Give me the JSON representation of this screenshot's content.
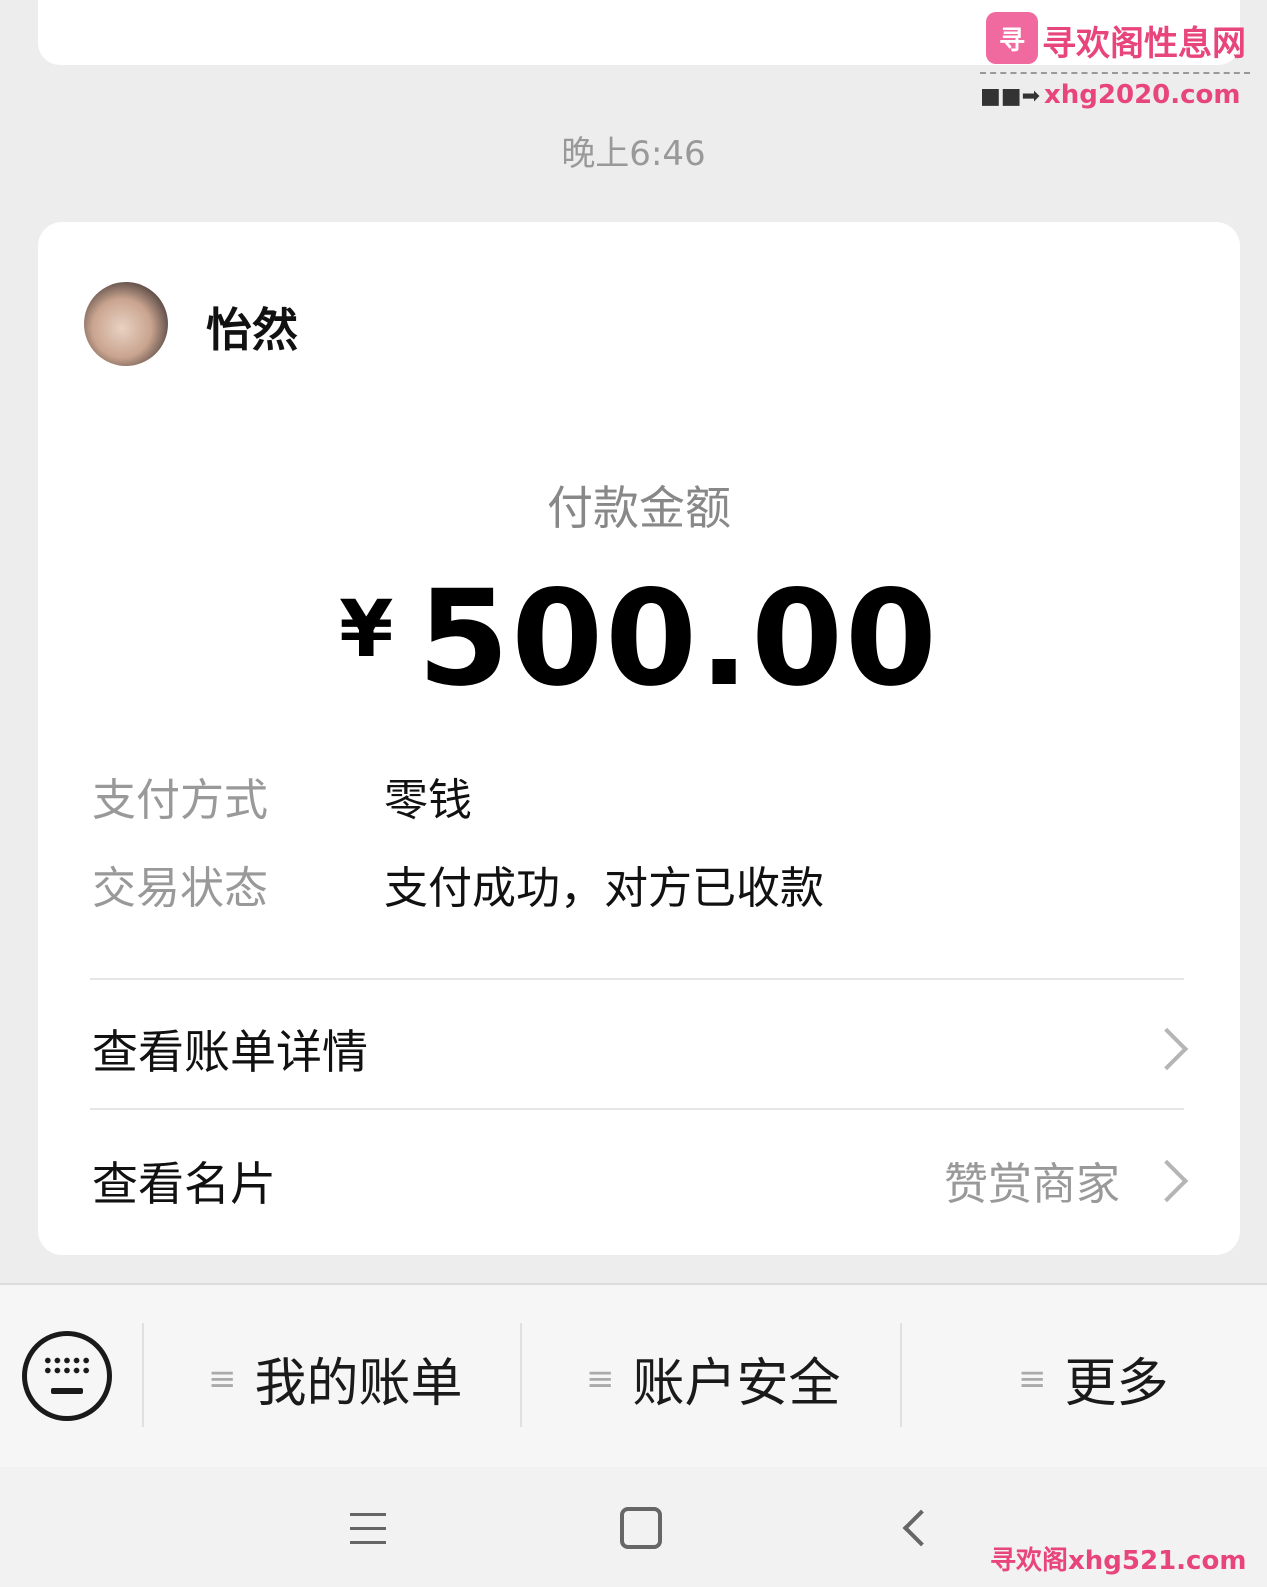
{
  "watermark": {
    "logo_text": "寻",
    "name": "寻欢阁性息网",
    "url": "xhg2020.com",
    "bottom": "寻欢阁xhg521.com"
  },
  "timestamp": "晚上6:46",
  "payment": {
    "payee_name": "怡然",
    "amount_label": "付款金额",
    "currency": "¥",
    "amount": "500.00",
    "method_label": "支付方式",
    "method_value": "零钱",
    "status_label": "交易状态",
    "status_value": "支付成功，对方已收款",
    "bill_details": "查看账单详情",
    "view_card": "查看名片",
    "reward_merchant": "赞赏商家"
  },
  "menu": {
    "items": [
      {
        "icon": "≡",
        "label": "我的账单"
      },
      {
        "icon": "≡",
        "label": "账户安全"
      },
      {
        "icon": "≡",
        "label": "更多"
      }
    ]
  },
  "icons": [
    "keyboard-icon",
    "menu-lines-icon",
    "nav-menu-icon",
    "nav-home-icon",
    "nav-back-icon",
    "chevron-right-icon"
  ]
}
